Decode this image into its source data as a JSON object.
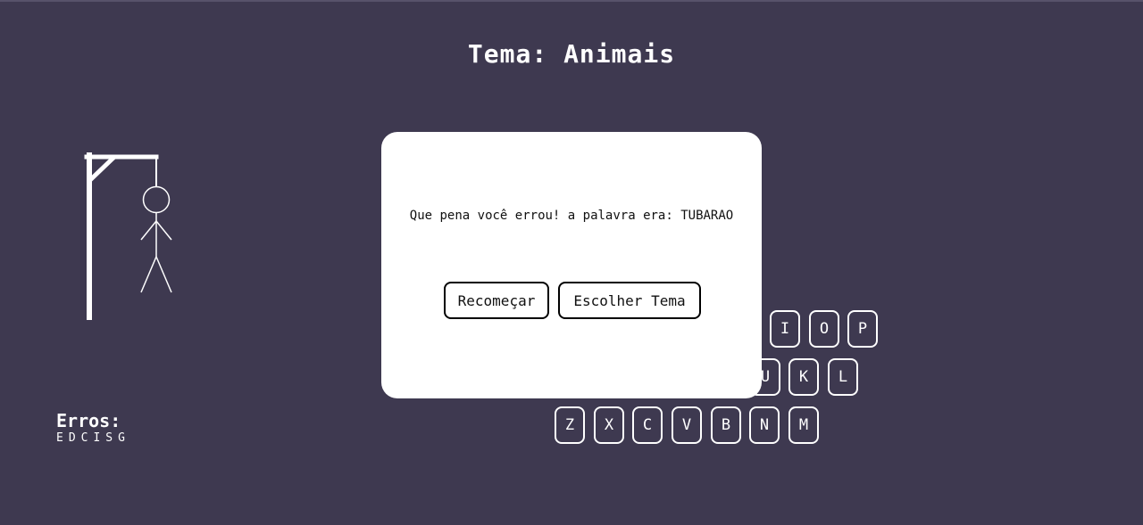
{
  "header": {
    "title": "Tema: Animais"
  },
  "errors": {
    "label": "Erros:",
    "letters": "EDCISG"
  },
  "keyboard": {
    "row1": [
      "I",
      "O",
      "P"
    ],
    "row2": [
      "U",
      "K",
      "L"
    ],
    "row3": [
      "Z",
      "X",
      "C",
      "V",
      "B",
      "N",
      "M"
    ]
  },
  "modal": {
    "message": "Que pena você errou! a palavra era: TUBARAO",
    "restart_label": "Recomeçar",
    "choose_theme_label": "Escolher Tema"
  },
  "hangman": {
    "wrong_guesses": 6
  }
}
